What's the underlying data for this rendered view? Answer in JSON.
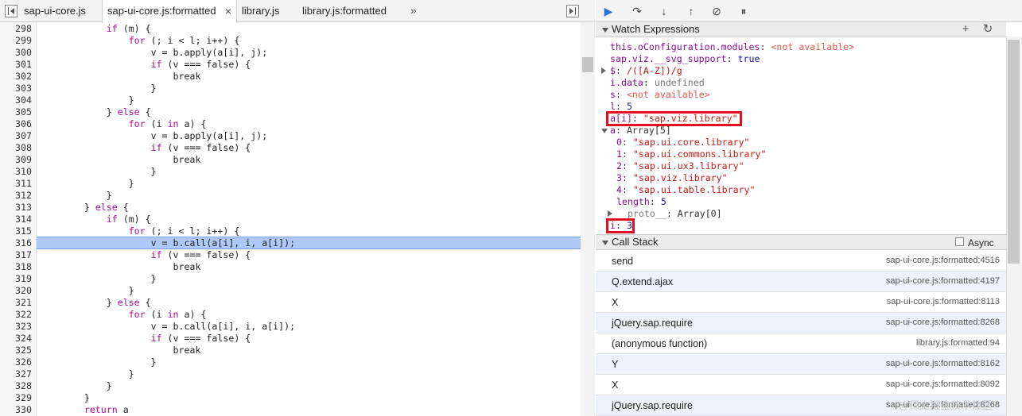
{
  "tabs": [
    {
      "label": "sap-ui-core.js",
      "active": false,
      "closable": false
    },
    {
      "label": "sap-ui-core.js:formatted",
      "active": true,
      "closable": true
    },
    {
      "label": "library.js",
      "active": false,
      "closable": false
    },
    {
      "label": "library.js:formatted",
      "active": false,
      "closable": false
    }
  ],
  "tabs_more": "»",
  "tab_close_glyph": "×",
  "code": {
    "highlight_line": 316,
    "lines": [
      {
        "n": "298",
        "t": "            if (m) {"
      },
      {
        "n": "299",
        "t": "                for (; i < l; i++) {"
      },
      {
        "n": "300",
        "t": "                    v = b.apply(a[i], j);"
      },
      {
        "n": "301",
        "t": "                    if (v === false) {"
      },
      {
        "n": "302",
        "t": "                        break"
      },
      {
        "n": "303",
        "t": "                    }"
      },
      {
        "n": "304",
        "t": "                }"
      },
      {
        "n": "305",
        "t": "            } else {"
      },
      {
        "n": "306",
        "t": "                for (i in a) {"
      },
      {
        "n": "307",
        "t": "                    v = b.apply(a[i], j);"
      },
      {
        "n": "308",
        "t": "                    if (v === false) {"
      },
      {
        "n": "309",
        "t": "                        break"
      },
      {
        "n": "310",
        "t": "                    }"
      },
      {
        "n": "311",
        "t": "                }"
      },
      {
        "n": "312",
        "t": "            }"
      },
      {
        "n": "313",
        "t": "        } else {"
      },
      {
        "n": "314",
        "t": "            if (m) {"
      },
      {
        "n": "315",
        "t": "                for (; i < l; i++) {"
      },
      {
        "n": "316",
        "t": "                    v = b.call(a[i], i, a[i]);"
      },
      {
        "n": "317",
        "t": "                    if (v === false) {"
      },
      {
        "n": "318",
        "t": "                        break"
      },
      {
        "n": "319",
        "t": "                    }"
      },
      {
        "n": "320",
        "t": "                }"
      },
      {
        "n": "321",
        "t": "            } else {"
      },
      {
        "n": "322",
        "t": "                for (i in a) {"
      },
      {
        "n": "323",
        "t": "                    v = b.call(a[i], i, a[i]);"
      },
      {
        "n": "324",
        "t": "                    if (v === false) {"
      },
      {
        "n": "325",
        "t": "                        break"
      },
      {
        "n": "326",
        "t": "                    }"
      },
      {
        "n": "327",
        "t": "                }"
      },
      {
        "n": "328",
        "t": "            }"
      },
      {
        "n": "329",
        "t": "        }"
      },
      {
        "n": "330",
        "t": "        return a"
      }
    ]
  },
  "debugger_buttons": [
    {
      "name": "resume-button",
      "glyph": "▶"
    },
    {
      "name": "step-over-button",
      "glyph": "↷"
    },
    {
      "name": "step-into-button",
      "glyph": "↓"
    },
    {
      "name": "step-out-button",
      "glyph": "↑"
    },
    {
      "name": "deactivate-breakpoints-button",
      "glyph": "⊘"
    },
    {
      "name": "pause-on-exceptions-button",
      "glyph": "⏸"
    }
  ],
  "watch": {
    "title": "Watch Expressions",
    "add_glyph": "+",
    "refresh_glyph": "↻",
    "items": [
      {
        "k": "this.oConfiguration.modules",
        "sep": ": ",
        "v": "<not available>",
        "vc": "wr",
        "kc": "wk",
        "arrow": ""
      },
      {
        "k": "sap.viz.__svg_support",
        "sep": ": ",
        "v": "true",
        "vc": "wv",
        "kc": "wk",
        "arrow": ""
      },
      {
        "k": "$",
        "sep": ": ",
        "v": "/([A-Z])/g",
        "vc": "ws",
        "kc": "wk",
        "arrow": "closed"
      },
      {
        "k": "i.data",
        "sep": ": ",
        "v": "undefined",
        "vc": "wg",
        "kc": "wk",
        "arrow": ""
      },
      {
        "k": "s",
        "sep": ": ",
        "v": "<not available>",
        "vc": "wr",
        "kc": "wk",
        "arrow": ""
      },
      {
        "k": "l",
        "sep": ": ",
        "v": "5",
        "vc": "wv",
        "kc": "wk",
        "arrow": ""
      },
      {
        "k": "a[i]",
        "sep": ": ",
        "v": "\"sap.viz.library\"",
        "vc": "ws",
        "kc": "wk",
        "arrow": "",
        "boxed": true
      },
      {
        "k": "a",
        "sep": ": ",
        "v": "Array[5]",
        "vc": "wn",
        "kc": "wk",
        "arrow": "open"
      },
      {
        "k": "0",
        "sep": ": ",
        "v": "\"sap.ui.core.library\"",
        "vc": "ws",
        "kc": "wk",
        "arrow": "",
        "indent": true
      },
      {
        "k": "1",
        "sep": ": ",
        "v": "\"sap.ui.commons.library\"",
        "vc": "ws",
        "kc": "wk",
        "arrow": "",
        "indent": true
      },
      {
        "k": "2",
        "sep": ": ",
        "v": "\"sap.ui.ux3.library\"",
        "vc": "ws",
        "kc": "wk",
        "arrow": "",
        "indent": true
      },
      {
        "k": "3",
        "sep": ": ",
        "v": "\"sap.viz.library\"",
        "vc": "ws",
        "kc": "wk",
        "arrow": "",
        "indent": true
      },
      {
        "k": "4",
        "sep": ": ",
        "v": "\"sap.ui.table.library\"",
        "vc": "ws",
        "kc": "wk",
        "arrow": "",
        "indent": true
      },
      {
        "k": "length",
        "sep": ": ",
        "v": "5",
        "vc": "wv",
        "kc": "wk",
        "arrow": "",
        "indent": true
      },
      {
        "k": "__proto__",
        "sep": ": ",
        "v": "Array[0]",
        "vc": "wn",
        "kc": "wg",
        "arrow": "closed",
        "indent": true
      },
      {
        "k": "i",
        "sep": ": ",
        "v": "3",
        "vc": "wv",
        "kc": "wk",
        "arrow": "",
        "boxed": true
      }
    ]
  },
  "callstack": {
    "title": "Call Stack",
    "async_label": "Async",
    "frames": [
      {
        "fn": "send",
        "loc": "sap-ui-core.js:formatted:4516"
      },
      {
        "fn": "Q.extend.ajax",
        "loc": "sap-ui-core.js:formatted:4197"
      },
      {
        "fn": "X",
        "loc": "sap-ui-core.js:formatted:8113"
      },
      {
        "fn": "jQuery.sap.require",
        "loc": "sap-ui-core.js:formatted:8268"
      },
      {
        "fn": "(anonymous function)",
        "loc": "library.js:formatted:94"
      },
      {
        "fn": "Y",
        "loc": "sap-ui-core.js:formatted:8162"
      },
      {
        "fn": "X",
        "loc": "sap-ui-core.js:formatted:8092"
      },
      {
        "fn": "jQuery.sap.require",
        "loc": "sap-ui-core.js:formatted:8268"
      }
    ]
  },
  "watermark": "@稀土掘金技术社区"
}
